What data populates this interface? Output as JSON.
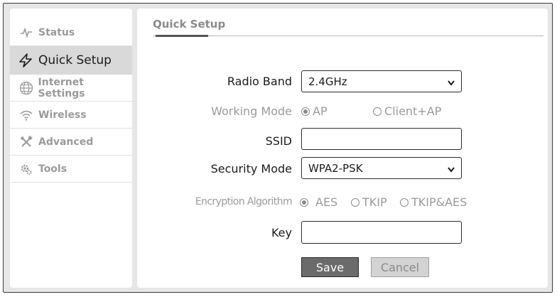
{
  "sidebar": {
    "items": [
      {
        "label": "Status",
        "icon": "pulse-icon"
      },
      {
        "label": "Quick Setup",
        "icon": "lightning-icon",
        "active": true
      },
      {
        "label": "Internet Settings",
        "icon": "globe-icon"
      },
      {
        "label": "Wireless",
        "icon": "wifi-icon"
      },
      {
        "label": "Advanced",
        "icon": "tools-icon"
      },
      {
        "label": "Tools",
        "icon": "gear-icon"
      }
    ]
  },
  "main": {
    "title": "Quick Setup",
    "form": {
      "radio_band": {
        "label": "Radio Band",
        "value": "2.4GHz"
      },
      "working_mode": {
        "label": "Working Mode",
        "options": [
          "AP",
          "Client+AP"
        ],
        "selected": "AP"
      },
      "ssid": {
        "label": "SSID",
        "value": ""
      },
      "security_mode": {
        "label": "Security Mode",
        "value": "WPA2-PSK"
      },
      "encryption": {
        "label": "Encryption Algorithm",
        "options": [
          "AES",
          "TKIP",
          "TKIP&AES"
        ],
        "selected": "AES"
      },
      "key": {
        "label": "Key",
        "value": ""
      }
    },
    "buttons": {
      "save": "Save",
      "cancel": "Cancel"
    }
  }
}
